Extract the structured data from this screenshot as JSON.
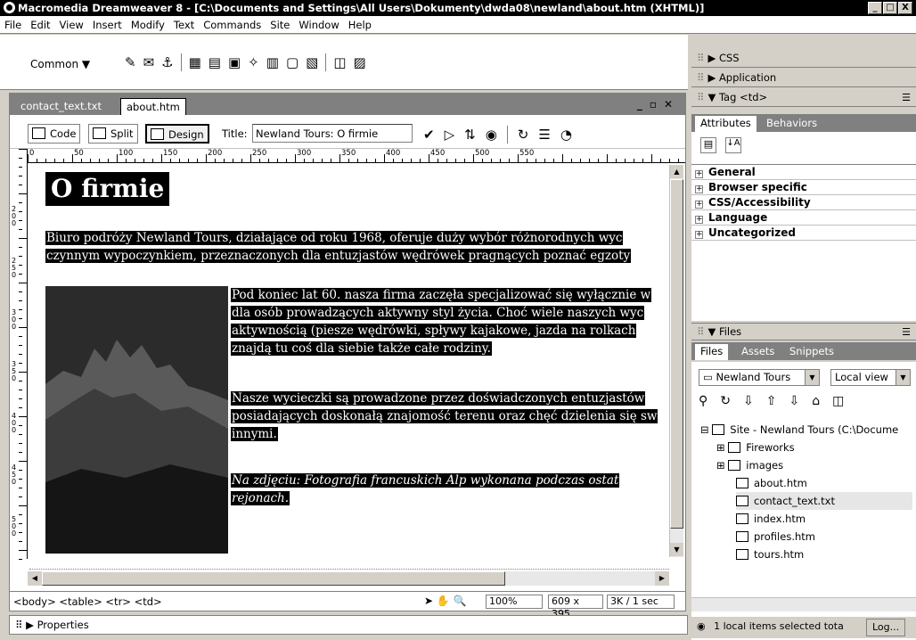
{
  "window": {
    "title": "Macromedia Dreamweaver 8 - [C:\\Documents and Settings\\All Users\\Dokumenty\\dwda08\\newland\\about.htm (XHTML)]",
    "buttons": [
      "_",
      "□",
      "X"
    ]
  },
  "menu": [
    "File",
    "Edit",
    "View",
    "Insert",
    "Modify",
    "Text",
    "Commands",
    "Site",
    "Window",
    "Help"
  ],
  "insert_bar": {
    "category": "Common ▼"
  },
  "document": {
    "tabs": [
      "contact_text.txt",
      "about.htm"
    ],
    "active_tab": "about.htm",
    "view_buttons": [
      "Code",
      "Split",
      "Design"
    ],
    "title_label": "Title:",
    "title_value": "Newland Tours: O firmie",
    "ruler_marks": [
      "0",
      "50",
      "100",
      "150",
      "200",
      "250",
      "300",
      "350",
      "400",
      "450",
      "500",
      "550"
    ],
    "vruler_marks": [
      "200",
      "250",
      "300",
      "350",
      "400",
      "450",
      "500"
    ],
    "heading": "O firmie",
    "para1_line1": "Biuro podróży Newland Tours, działające od roku 1968, oferuje duży wybór różnorodnych wyc",
    "para1_line2": "czynnym wypoczynkiem, przeznaczonych dla entuzjastów wędrówek pragnących poznać egzoty",
    "para2": [
      "Pod koniec lat 60. nasza firma zaczęła specjalizować się wyłącznie w",
      "dla osób prowadzących aktywny styl życia. Choć wiele naszych wyc",
      "aktywnością (piesze wędrówki, spływy kajakowe, jazda na rolkach",
      "znajdą tu coś dla siebie także całe rodziny."
    ],
    "para3": [
      "Nasze wycieczki są prowadzone przez doświadczonych entuzjastów",
      "posiadających doskonałą znajomość terenu oraz chęć dzielenia się sw",
      "innymi."
    ],
    "para4": [
      "Na zdjęciu: Fotografia francuskich Alp wykonana podczas ostat",
      "rejonach."
    ],
    "tag_selector": "<body> <table> <tr> <td>",
    "zoom": "100%",
    "size": "609 x 395",
    "download": "3K / 1 sec"
  },
  "properties_label": "Properties",
  "panels": {
    "css": "CSS",
    "application": "Application",
    "tag": "Tag <td>",
    "tag_tabs": [
      "Attributes",
      "Behaviors"
    ],
    "groups": [
      "General",
      "Browser specific",
      "CSS/Accessibility",
      "Language",
      "Uncategorized"
    ],
    "files_header": "Files",
    "files_tabs": [
      "Files",
      "Assets",
      "Snippets"
    ],
    "site_select": "Newland Tours",
    "view_select": "Local view",
    "tree": [
      {
        "label": "Site - Newland Tours (C:\\Docume",
        "kind": "site"
      },
      {
        "label": "Fireworks",
        "kind": "folder"
      },
      {
        "label": "images",
        "kind": "folder"
      },
      {
        "label": "about.htm",
        "kind": "htm"
      },
      {
        "label": "contact_text.txt",
        "kind": "txt"
      },
      {
        "label": "index.htm",
        "kind": "htm"
      },
      {
        "label": "profiles.htm",
        "kind": "htm"
      },
      {
        "label": "tours.htm",
        "kind": "htm"
      }
    ],
    "status": "1 local items selected tota",
    "log_button": "Log..."
  }
}
